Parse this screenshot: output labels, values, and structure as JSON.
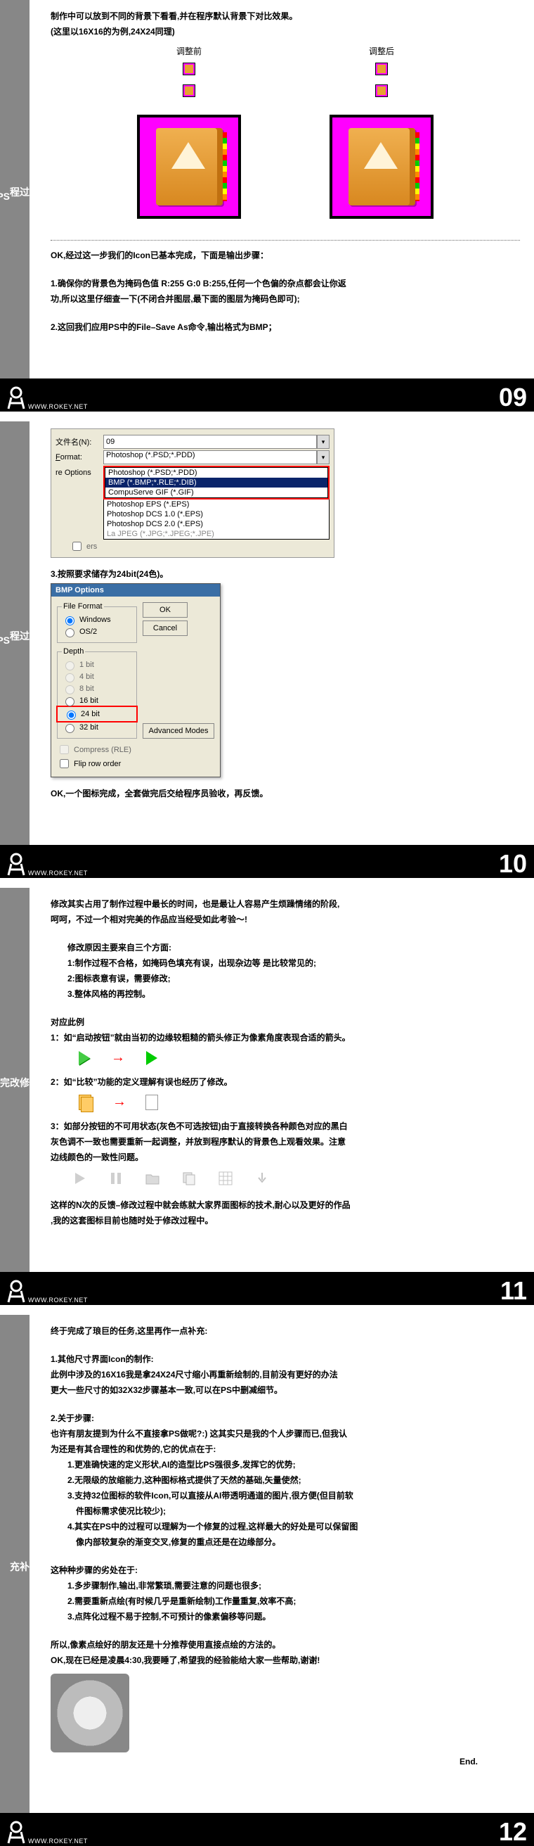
{
  "sections": {
    "s09": {
      "sidebar_title": "过程",
      "sidebar_sub": "PS",
      "intro_l1": "制作中可以放到不同的背景下看看,并在程序默认背景下对比效果。",
      "intro_l2": "(这里以16X16的为例,24X24同理)",
      "before_label": "调整前",
      "after_label": "调整后",
      "ok_line": "OK,经过这一步我们的Icon已基本完成，下面是输出步骤：",
      "step1_l1": "1.确保你的背景色为掩码色值 R:255 G:0 B:255,任何一个色偏的杂点都会让你返",
      "step1_l2": "功,所以这里仔细查一下(不闭合并图层,最下面的图层为掩码色即可);",
      "step2": "2.这回我们应用PS中的File–Save As命令,输出格式为BMP；",
      "page_num": "09"
    },
    "s10": {
      "sidebar_title": "过程",
      "sidebar_sub": "PS",
      "filename_label": "文件名(N):",
      "filename_value": "09",
      "format_label": "Format:",
      "format_value": "Photoshop (*.PSD;*.PDD)",
      "options_label": "re Options",
      "dropdown": {
        "i0": "Photoshop (*.PSD;*.PDD)",
        "i1": "BMP (*.BMP;*.RLE;*.DIB)",
        "i2": "CompuServe GIF (*.GIF)",
        "i3": "Photoshop EPS (*.EPS)",
        "i4": "Photoshop DCS 1.0 (*.EPS)",
        "i5": "Photoshop DCS 2.0 (*.EPS)",
        "i6": "La JPEG (*.JPG;*.JPEG;*.JPE)"
      },
      "chk1": "ers",
      "step3": "3.按照要求储存为24bit(24色)。",
      "bmp": {
        "title": "BMP Options",
        "grp_format": "File Format",
        "r_windows": "Windows",
        "r_os2": "OS/2",
        "grp_depth": "Depth",
        "d1": "1 bit",
        "d4": "4 bit",
        "d8": "8 bit",
        "d16": "16 bit",
        "d24": "24 bit",
        "d32": "32 bit",
        "chk_compress": "Compress (RLE)",
        "chk_flip": "Flip row order",
        "btn_ok": "OK",
        "btn_cancel": "Cancel",
        "btn_adv": "Advanced Modes"
      },
      "done": "OK,一个图标完成，全套做完后交给程序员验收，再反馈。",
      "page_num": "10"
    },
    "s11": {
      "sidebar_title": "修改完善",
      "p1_l1": "修改其实占用了制作过程中最长的时间，也是最让人容易产生烦躁情绪的阶段,",
      "p1_l2": "呵呵，不过一个相对完美的作品应当经受如此考验～!",
      "reason_h": "修改原因主要来自三个方面:",
      "r1": "1:制作过程不合格，如掩码色填充有误，出现杂边等 是比较常见的;",
      "r2": "2:图标表意有误，需要修改;",
      "r3": "3.整体风格的再控制。",
      "case_h": "对应此例",
      "c1": "1：如“启动按钮”就由当初的边缘较粗糙的箭头修正为像素角度表现合适的箭头。",
      "c2": "2：如“比较”功能的定义理解有误也经历了修改。",
      "c3_l1": "3：如部分按钮的不可用状态(灰色不可选按钮)由于直接转换各种颜色对应的黑白",
      "c3_l2": "灰色调不一致也需要重新一起调整，并放到程序默认的背景色上观看效果。注意",
      "c3_l3": "边线颜色的一致性问题。",
      "summary_l1": "这样的N次的反馈–修改过程中就会练就大家界面图标的技术,耐心以及更好的作品",
      "summary_l2": ",我的这套图标目前也随时处于修改过程中。",
      "page_num": "11"
    },
    "s12": {
      "sidebar_title": "补充",
      "intro": "终于完成了琅巨的任务,这里再作一点补充:",
      "h1": "1.其他尺寸界面Icon的制作:",
      "h1_l1": "此例中涉及的16X16我是拿24X24尺寸缩小再重新绘制的,目前没有更好的办法",
      "h1_l2": "更大一些尺寸的如32X32步骤基本一致,可以在PS中删减细节。",
      "h2": "2.关于步骤:",
      "h2_l1": "也许有朋友提到为什么不直接拿PS做呢?:) 这其实只是我的个人步骤而已,但我认",
      "h2_l2": "为还是有其合理性的和优势的,它的优点在于:",
      "b1": "1.更准确快速的定义形状,AI的造型比PS强很多,发挥它的优势;",
      "b2": "2.无限级的放缩能力,这种图标格式提供了天然的基础,矢量使然;",
      "b3_l1": "3.支持32位图标的软件Icon,可以直接从AI带透明通道的图片,很方便(但目前软",
      "b3_l2": "件图标需求使况比较少);",
      "b4_l1": "4.其实在PS中的过程可以理解为一个修复的过程,这样最大的好处是可以保留图",
      "b4_l2": "像内部较复杂的渐变交叉,修复的重点还是在边缘部分。",
      "weak_h": "这种种步骤的劣处在于:",
      "w1": "1.多步骤制作,输出,非常繁琐,需要注意的问题也很多;",
      "w2": "2.需要重新点绘(有时候几乎是重新绘制)工作量重复,效率不高;",
      "w3": "3.点阵化过程不易于控制,不可预计的像素偏移等问题。",
      "close_l1": "所以,像素点绘好的朋友还是十分推荐使用直接点绘的方法的。",
      "close_l2": "OK,现在已经是凌晨4:30,我要睡了,希望我的经验能给大家一些帮助,谢谢!",
      "end": "End.",
      "page_num": "12"
    },
    "footer_url": "WWW.ROKEY.NET"
  }
}
